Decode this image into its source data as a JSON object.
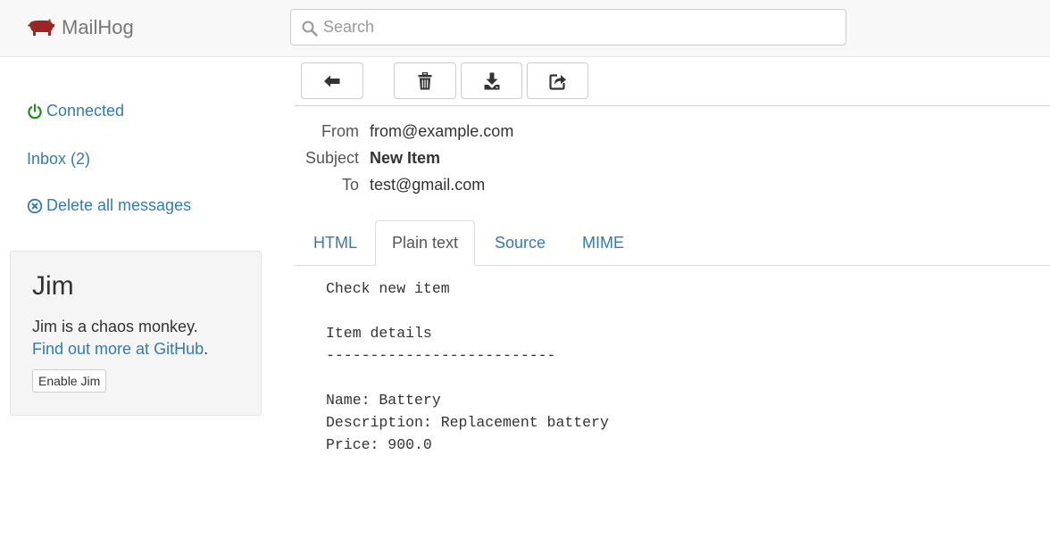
{
  "app": {
    "name": "MailHog"
  },
  "search": {
    "placeholder": "Search",
    "value": ""
  },
  "sidebar": {
    "connected_label": "Connected",
    "inbox_label": "Inbox (2)",
    "delete_all_label": "Delete all messages"
  },
  "jim": {
    "title": "Jim",
    "description": "Jim is a chaos monkey.",
    "link_text": "Find out more at GitHub",
    "link_suffix": ".",
    "button_label": "Enable Jim"
  },
  "message": {
    "headers": [
      {
        "label": "From",
        "value": "from@example.com"
      },
      {
        "label": "Subject",
        "value": "New Item"
      },
      {
        "label": "To",
        "value": "test@gmail.com"
      }
    ],
    "tabs": [
      {
        "label": "HTML",
        "active": false
      },
      {
        "label": "Plain text",
        "active": true
      },
      {
        "label": "Source",
        "active": false
      },
      {
        "label": "MIME",
        "active": false
      }
    ],
    "body": "Check new item\n\nItem details\n--------------------------\n\nName: Battery\nDescription: Replacement battery\nPrice: 900.0"
  },
  "colors": {
    "link": "#337ab7",
    "connected_icon": "#1a8f1a",
    "brand_logo": "#9b2424"
  },
  "icons": {
    "logo": "pig-icon",
    "search": "search-icon",
    "back": "arrow-left-icon",
    "delete": "trash-icon",
    "download": "download-icon",
    "release": "share-icon",
    "connected": "power-icon",
    "delete_all": "circle-x-icon"
  }
}
